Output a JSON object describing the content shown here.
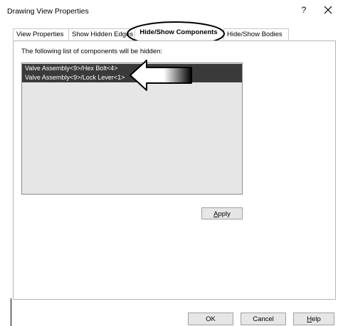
{
  "dialog": {
    "title": "Drawing View Properties",
    "help_glyph": "?",
    "close_glyph": "×"
  },
  "tabs": [
    {
      "label": "View Properties"
    },
    {
      "label": "Show Hidden Edges"
    },
    {
      "label": "Hide/Show Components",
      "selected": true
    },
    {
      "label": "Hide/Show Bodies"
    }
  ],
  "panel": {
    "instruction": "The following list of components will be hidden:",
    "components": [
      {
        "label": "Valve Assembly<9>/Hex Bolt<4>"
      },
      {
        "label": "Valve Assembly<9>/Lock Lever<1>"
      }
    ],
    "apply_label_first": "A",
    "apply_label_rest": "pply"
  },
  "footer": {
    "ok_label": "OK",
    "cancel_label": "Cancel",
    "help_label_first": "H",
    "help_label_rest": "elp"
  },
  "colors": {
    "selection_bg": "#3a3a3a",
    "list_bg": "#e6e6e6",
    "button_bg": "#e6e6e6"
  },
  "icons": [
    "close-icon",
    "callout-arrow",
    "tab-highlight-ellipse"
  ]
}
